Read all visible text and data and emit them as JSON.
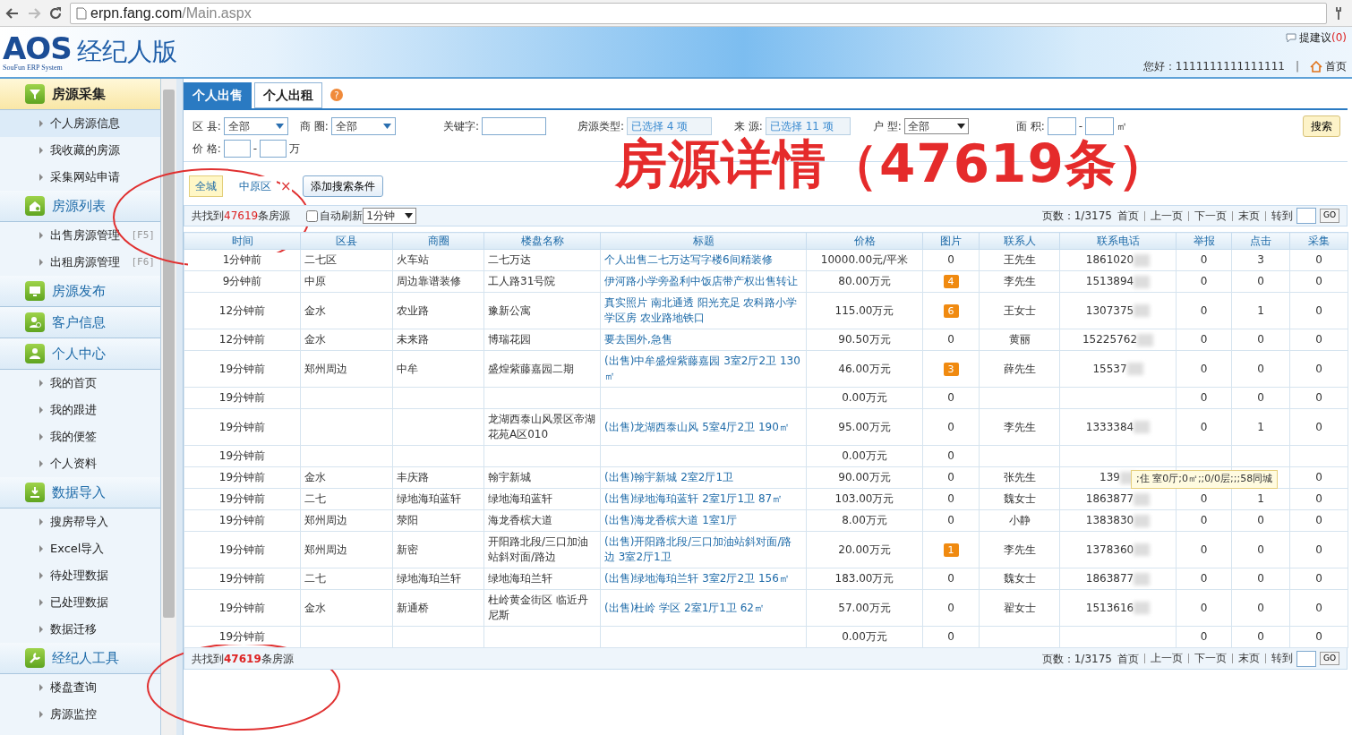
{
  "browser": {
    "url_host": "erpn.fang.com",
    "url_path": "/Main.aspx"
  },
  "header": {
    "logo": "AOS",
    "logo_sub": "SouFun ERP System",
    "edition": "经纪人版",
    "feedback": "提建议",
    "feedback_count": "(0)",
    "greeting": "您好：1111111111111111",
    "separator": "|",
    "home": "首页"
  },
  "sidebar": {
    "sections": [
      {
        "title": "房源采集",
        "selected": true,
        "items": [
          {
            "label": "个人房源信息",
            "selected": true
          },
          {
            "label": "我收藏的房源",
            "selected": false
          },
          {
            "label": "采集网站申请",
            "selected": false
          }
        ]
      },
      {
        "title": "房源列表",
        "selected": false,
        "items": [
          {
            "label": "出售房源管理",
            "shortcut": "[F5]",
            "selected": false
          },
          {
            "label": "出租房源管理",
            "shortcut": "[F6]",
            "selected": false
          }
        ]
      },
      {
        "title": "房源发布",
        "selected": false
      },
      {
        "title": "客户信息",
        "selected": false
      },
      {
        "title": "个人中心",
        "selected": false,
        "items": [
          {
            "label": "我的首页",
            "selected": false
          },
          {
            "label": "我的跟进",
            "selected": false
          },
          {
            "label": "我的便签",
            "selected": false
          },
          {
            "label": "个人资料",
            "selected": false
          }
        ]
      },
      {
        "title": "数据导入",
        "selected": false,
        "items": [
          {
            "label": "搜房帮导入",
            "selected": false
          },
          {
            "label": "Excel导入",
            "selected": false
          },
          {
            "label": "待处理数据",
            "selected": false
          },
          {
            "label": "已处理数据",
            "selected": false
          },
          {
            "label": "数据迁移",
            "selected": false
          }
        ]
      },
      {
        "title": "经纪人工具",
        "selected": false,
        "items": [
          {
            "label": "楼盘查询",
            "selected": false
          },
          {
            "label": "房源监控",
            "selected": false
          }
        ]
      }
    ]
  },
  "tabs": [
    {
      "label": "个人出售",
      "selected": true
    },
    {
      "label": "个人出租",
      "selected": false
    }
  ],
  "help": "?",
  "filters": [
    {
      "kind": "select",
      "label": "区 县:",
      "value": "全部"
    },
    {
      "kind": "select",
      "label": "商 圈:",
      "value": "全部"
    },
    {
      "kind": "text",
      "label": "关键字:"
    },
    {
      "kind": "multi",
      "label": "房源类型:",
      "value": "已选择 4 项"
    },
    {
      "kind": "multi",
      "label": "来 源:",
      "value": "已选择 11 项"
    },
    {
      "kind": "native",
      "label": "户 型:",
      "value": "全部"
    },
    {
      "kind": "range",
      "label": "面 积:",
      "dash": "-",
      "unit": "㎡"
    },
    {
      "kind": "range",
      "label": "价 格:",
      "dash": "-",
      "unit": "万"
    }
  ],
  "search_button": "搜索",
  "chips": [
    {
      "label": "全城",
      "selected": true
    },
    {
      "label": "中原区",
      "selected": false,
      "remove": "×"
    }
  ],
  "add_condition": "添加搜索条件",
  "annotation": "房源详情（47619条）",
  "summary": {
    "prefix": "共找到",
    "count": "47619",
    "suffix": "条房源",
    "auto_refresh": {
      "label": "自动刷新",
      "checked": false,
      "interval": "1分钟"
    }
  },
  "pager": {
    "info": "页数：1/3175",
    "links": [
      "首页",
      "上一页",
      "下一页",
      "末页"
    ],
    "goto": "转到",
    "go": "GO"
  },
  "table": {
    "columns": [
      "时间",
      "区县",
      "商圈",
      "楼盘名称",
      "标题",
      "价格",
      "图片",
      "联系人",
      "联系电话",
      "举报",
      "点击",
      "采集"
    ],
    "rows": [
      {
        "time": "1分钟前",
        "district": "二七区",
        "area": "火车站",
        "estate": "二七万达",
        "title": "个人出售二七万达写字楼6间精装修",
        "price": "10000.00元/平米",
        "photos": "0",
        "photo_badge": false,
        "contact": "王先生",
        "phone": "1861020",
        "reports": "0",
        "clicks": "3",
        "collected": "0"
      },
      {
        "time": "9分钟前",
        "district": "中原",
        "area": "周边靠谱装修",
        "estate": "工人路31号院",
        "title": "伊河路小学旁盈利中饭店带产权出售转让",
        "price": "80.00万元",
        "photos": "4",
        "photo_badge": true,
        "contact": "李先生",
        "phone": "1513894",
        "reports": "0",
        "clicks": "0",
        "collected": "0"
      },
      {
        "time": "12分钟前",
        "district": "金水",
        "area": "农业路",
        "estate": "豫新公寓",
        "title": "真实照片 南北通透 阳光充足 农科路小学学区房 农业路地铁口",
        "price": "115.00万元",
        "photos": "6",
        "photo_badge": true,
        "contact": "王女士",
        "phone": "1307375",
        "reports": "0",
        "clicks": "1",
        "collected": "0"
      },
      {
        "time": "12分钟前",
        "district": "金水",
        "area": "未来路",
        "estate": "博瑞花园",
        "title": "要去国外,急售",
        "price": "90.50万元",
        "photos": "0",
        "photo_badge": false,
        "contact": "黄丽",
        "phone": "15225762",
        "reports": "0",
        "clicks": "0",
        "collected": "0"
      },
      {
        "time": "19分钟前",
        "district": "郑州周边",
        "area": "中牟",
        "estate": "盛煌紫藤嘉园二期",
        "title": "(出售)中牟盛煌紫藤嘉园 3室2厅2卫 130㎡",
        "price": "46.00万元",
        "photos": "3",
        "photo_badge": true,
        "contact": "薛先生",
        "phone": "15537",
        "reports": "0",
        "clicks": "0",
        "collected": "0"
      },
      {
        "time": "19分钟前",
        "price": "0.00万元",
        "photos": "0",
        "photo_badge": false,
        "reports": "0",
        "clicks": "0",
        "collected": "0"
      },
      {
        "time": "19分钟前",
        "estate": "龙湖西泰山风景区帝湖花苑A区010",
        "title": "(出售)龙湖西泰山风 5室4厅2卫 190㎡",
        "price": "95.00万元",
        "photos": "0",
        "photo_badge": false,
        "contact": "李先生",
        "phone": "1333384",
        "reports": "0",
        "clicks": "1",
        "collected": "0"
      },
      {
        "time": "19分钟前",
        "price": "0.00万元",
        "photos": "0",
        "photo_badge": false
      },
      {
        "time": "19分钟前",
        "district": "金水",
        "area": "丰庆路",
        "estate": "翰宇新城",
        "title": "(出售)翰宇新城 2室2厅1卫",
        "price": "90.00万元",
        "photos": "0",
        "photo_badge": false,
        "contact": "张先生",
        "phone": "139",
        "collected": "0"
      },
      {
        "time": "19分钟前",
        "district": "二七",
        "area": "绿地海珀蓝轩",
        "estate": "绿地海珀蓝轩",
        "title": "(出售)绿地海珀蓝轩 2室1厅1卫 87㎡",
        "price": "103.00万元",
        "photos": "0",
        "photo_badge": false,
        "contact": "魏女士",
        "phone": "1863877",
        "reports": "0",
        "clicks": "1",
        "collected": "0"
      },
      {
        "time": "19分钟前",
        "district": "郑州周边",
        "area": "荥阳",
        "estate": "海龙香槟大道",
        "title": "(出售)海龙香槟大道 1室1厅",
        "price": "8.00万元",
        "photos": "0",
        "photo_badge": false,
        "contact": "小静",
        "phone": "1383830",
        "reports": "0",
        "clicks": "0",
        "collected": "0"
      },
      {
        "time": "19分钟前",
        "district": "郑州周边",
        "area": "新密",
        "estate": "开阳路北段/三口加油站斜对面/路边",
        "title": "(出售)开阳路北段/三口加油站斜对面/路边 3室2厅1卫",
        "price": "20.00万元",
        "photos": "1",
        "photo_badge": true,
        "contact": "李先生",
        "phone": "1378360",
        "reports": "0",
        "clicks": "0",
        "collected": "0"
      },
      {
        "time": "19分钟前",
        "district": "二七",
        "area": "绿地海珀兰轩",
        "estate": "绿地海珀兰轩",
        "title": "(出售)绿地海珀兰轩 3室2厅2卫 156㎡",
        "price": "183.00万元",
        "photos": "0",
        "photo_badge": false,
        "contact": "魏女士",
        "phone": "1863877",
        "reports": "0",
        "clicks": "0",
        "collected": "0"
      },
      {
        "time": "19分钟前",
        "district": "金水",
        "area": "新通桥",
        "estate": "杜岭黄金街区 临近丹尼斯",
        "title": "(出售)杜岭 学区 2室1厅1卫 62㎡",
        "price": "57.00万元",
        "photos": "0",
        "photo_badge": false,
        "contact": "翟女士",
        "phone": "1513616",
        "reports": "0",
        "clicks": "0",
        "collected": "0"
      },
      {
        "time": "19分钟前",
        "price": "0.00万元",
        "photos": "0",
        "photo_badge": false,
        "reports": "0",
        "clicks": "0",
        "collected": "0"
      }
    ]
  },
  "tooltip": ";住 室0厅;0㎡;;0/0层;;;58同城",
  "footer": {
    "prefix": "共找到",
    "count": "47619",
    "suffix": "条房源"
  },
  "footer_pager": {
    "info": "页数：1/3175",
    "links": [
      "首页",
      "上一页",
      "下一页",
      "末页"
    ],
    "goto": "转到",
    "go": "GO"
  }
}
